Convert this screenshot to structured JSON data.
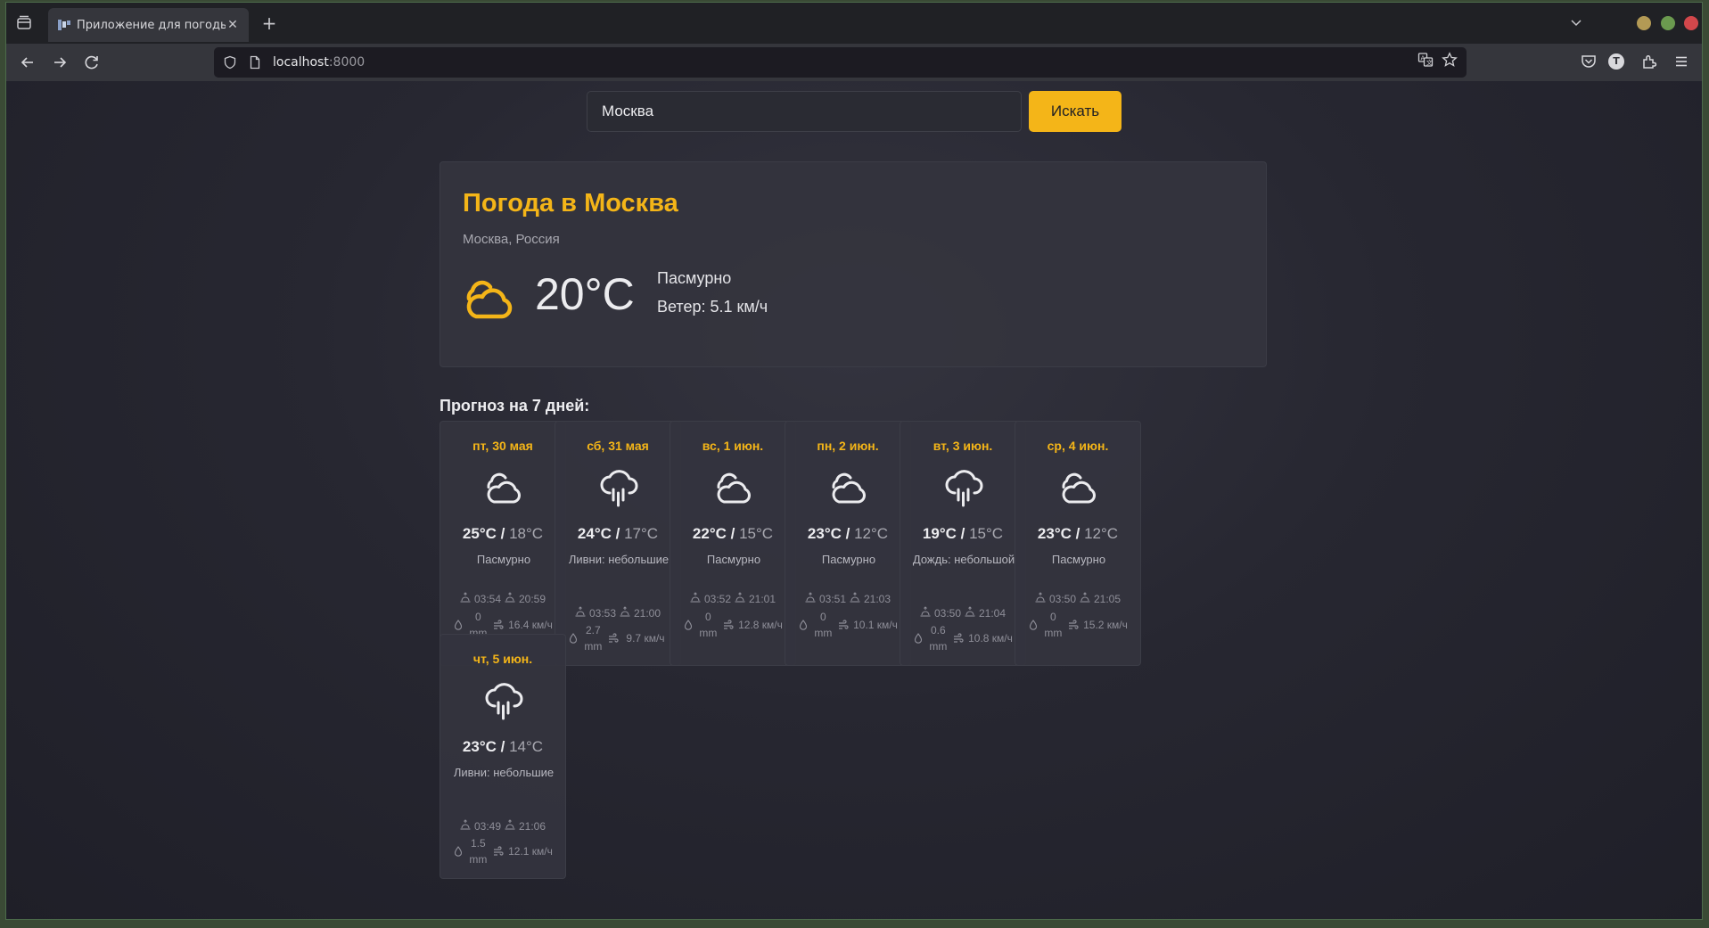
{
  "browser": {
    "tab_title": "Приложение для погоды",
    "url_host": "localhost",
    "url_port": ":8000"
  },
  "search": {
    "value": "Москва",
    "button_label": "Искать"
  },
  "current": {
    "title": "Погода в Москва",
    "location": "Москва, Россия",
    "temp": "20°C",
    "description": "Пасмурно",
    "wind": "Ветер: 5.1 км/ч",
    "icon": "cloud-sun-icon"
  },
  "forecast": {
    "title": "Прогноз на 7 дней:",
    "days": [
      {
        "date": "пт, 30 мая",
        "icon": "cloud-icon",
        "hi": "25°C",
        "lo": "18°C",
        "desc": "Пасмурно",
        "sunrise": "03:54",
        "sunset": "20:59",
        "precip": "0 mm",
        "wind": "16.4 км/ч"
      },
      {
        "date": "сб, 31 мая",
        "icon": "rain-icon",
        "hi": "24°C",
        "lo": "17°C",
        "desc": "Ливни: небольшие",
        "sunrise": "03:53",
        "sunset": "21:00",
        "precip": "2.7 mm",
        "wind": "9.7 км/ч"
      },
      {
        "date": "вс, 1 июн.",
        "icon": "cloud-icon",
        "hi": "22°C",
        "lo": "15°C",
        "desc": "Пасмурно",
        "sunrise": "03:52",
        "sunset": "21:01",
        "precip": "0 mm",
        "wind": "12.8 км/ч"
      },
      {
        "date": "пн, 2 июн.",
        "icon": "cloud-icon",
        "hi": "23°C",
        "lo": "12°C",
        "desc": "Пасмурно",
        "sunrise": "03:51",
        "sunset": "21:03",
        "precip": "0 mm",
        "wind": "10.1 км/ч"
      },
      {
        "date": "вт, 3 июн.",
        "icon": "rain-icon",
        "hi": "19°C",
        "lo": "15°C",
        "desc": "Дождь: небольшой",
        "sunrise": "03:50",
        "sunset": "21:04",
        "precip": "0.6 mm",
        "wind": "10.8 км/ч"
      },
      {
        "date": "ср, 4 июн.",
        "icon": "cloud-icon",
        "hi": "23°C",
        "lo": "12°C",
        "desc": "Пасмурно",
        "sunrise": "03:50",
        "sunset": "21:05",
        "precip": "0 mm",
        "wind": "15.2 км/ч"
      },
      {
        "date": "чт, 5 июн.",
        "icon": "rain-icon",
        "hi": "23°C",
        "lo": "14°C",
        "desc": "Ливни: небольшие",
        "sunrise": "03:49",
        "sunset": "21:06",
        "precip": "1.5 mm",
        "wind": "12.1 км/ч"
      }
    ]
  },
  "colors": {
    "accent": "#f4b518",
    "background": "#1f2026",
    "card": "#34343e"
  }
}
